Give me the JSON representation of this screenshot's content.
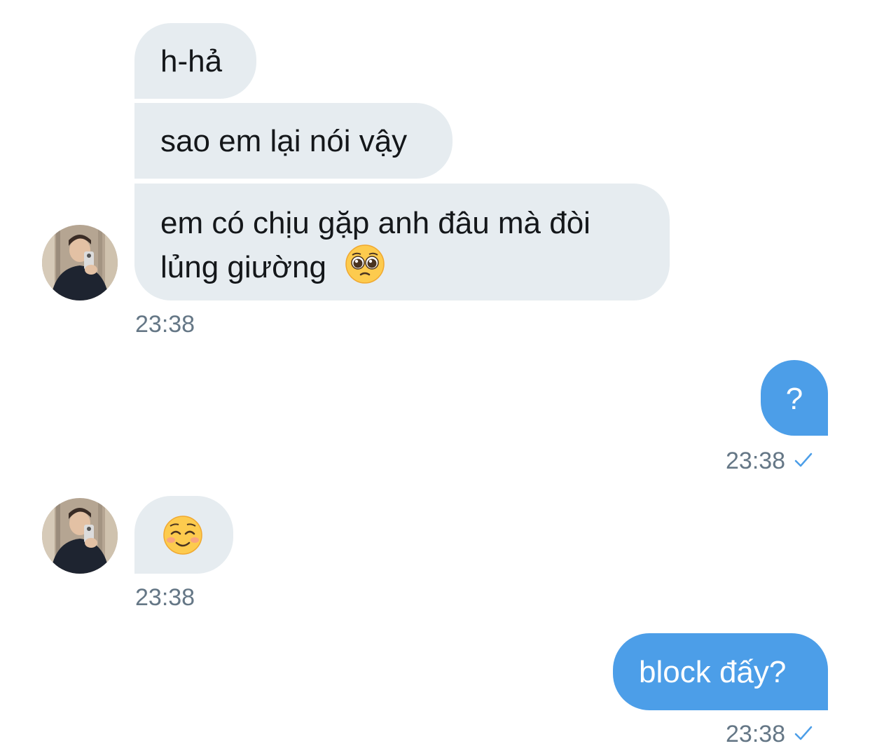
{
  "colors": {
    "received_bubble": "#e6ecf0",
    "sent_bubble": "#4c9ee8",
    "timestamp": "#657786",
    "read_check": "#4c9ee8"
  },
  "messages": [
    {
      "side": "received",
      "text": "h-hả"
    },
    {
      "side": "received",
      "text": "sao em lại nói vậy"
    },
    {
      "side": "received",
      "line1": "em có chịu gặp anh đâu mà đòi",
      "line2": "lủng giường",
      "emoji": "pleading-face-emoji",
      "time": "23:38"
    },
    {
      "side": "sent",
      "text": "?",
      "time": "23:38",
      "status_icon": "read-check-icon"
    },
    {
      "side": "received",
      "emoji": "smiling-face-emoji",
      "time": "23:38"
    },
    {
      "side": "sent",
      "text": "block đấy?",
      "time": "23:38",
      "status_icon": "read-check-icon"
    }
  ]
}
